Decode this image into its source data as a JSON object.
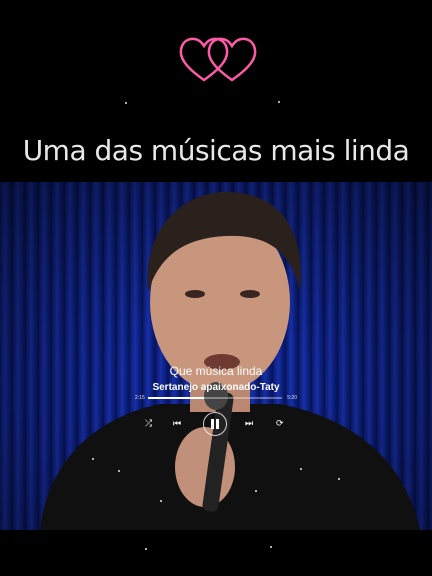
{
  "overlay": {
    "title": "Uma das músicas mais linda",
    "heart_icon": "double-heart-icon",
    "heart_color": "#ff5aa8"
  },
  "player": {
    "song_title": "Que música linda",
    "artist": "Sertanejo apaixonado-Taty",
    "time_elapsed": "2:15",
    "time_total": "5:20",
    "progress": 0.42,
    "controls": {
      "shuffle": "shuffle-icon",
      "previous": "previous-icon",
      "pause": "pause-icon",
      "next": "next-icon",
      "repeat": "repeat-icon"
    }
  }
}
